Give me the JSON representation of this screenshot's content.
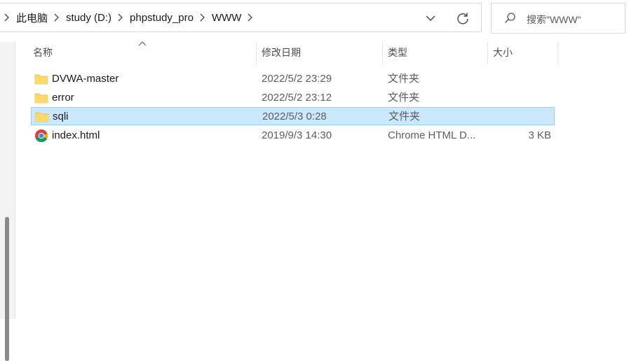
{
  "address_bar": {
    "breadcrumbs": [
      "此电脑",
      "study (D:)",
      "phpstudy_pro",
      "WWW"
    ]
  },
  "search": {
    "placeholder": "搜索\"WWW\""
  },
  "columns": {
    "name": "名称",
    "date": "修改日期",
    "type": "类型",
    "size": "大小"
  },
  "files": [
    {
      "name": "DVWA-master",
      "date": "2022/5/2 23:29",
      "type": "文件夹",
      "size": "",
      "icon": "folder-icon",
      "selected": false
    },
    {
      "name": "error",
      "date": "2022/5/2 23:12",
      "type": "文件夹",
      "size": "",
      "icon": "folder-icon",
      "selected": false
    },
    {
      "name": "sqli",
      "date": "2022/5/3 0:28",
      "type": "文件夹",
      "size": "",
      "icon": "folder-icon",
      "selected": true
    },
    {
      "name": "index.html",
      "date": "2019/9/3 14:30",
      "type": "Chrome HTML D...",
      "size": "3 KB",
      "icon": "chrome-icon",
      "selected": false
    }
  ],
  "colors": {
    "selection_bg": "#cce8ff",
    "selection_border": "#99d1ff",
    "folder": "#f8d775"
  }
}
